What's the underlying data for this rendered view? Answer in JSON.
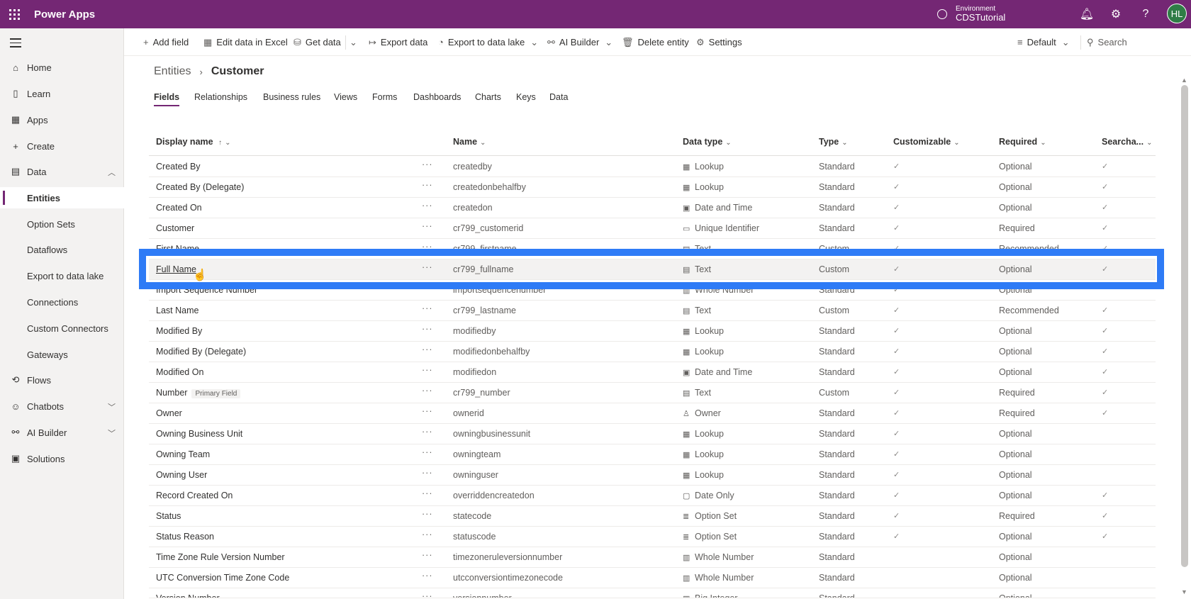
{
  "app": {
    "title": "Power Apps"
  },
  "environment": {
    "label": "Environment",
    "name": "CDSTutorial"
  },
  "user": {
    "initials": "HL"
  },
  "sidebar": {
    "items": [
      {
        "label": "Home",
        "icon": "home-icon"
      },
      {
        "label": "Learn",
        "icon": "book-icon"
      },
      {
        "label": "Apps",
        "icon": "apps-icon"
      },
      {
        "label": "Create",
        "icon": "plus-icon"
      },
      {
        "label": "Data",
        "icon": "table-icon"
      },
      {
        "label": "Entities"
      },
      {
        "label": "Option Sets"
      },
      {
        "label": "Dataflows"
      },
      {
        "label": "Export to data lake"
      },
      {
        "label": "Connections"
      },
      {
        "label": "Custom Connectors"
      },
      {
        "label": "Gateways"
      },
      {
        "label": "Flows",
        "icon": "flow-icon"
      },
      {
        "label": "Chatbots",
        "icon": "bot-icon"
      },
      {
        "label": "AI Builder",
        "icon": "ai-icon"
      },
      {
        "label": "Solutions",
        "icon": "solutions-icon"
      }
    ]
  },
  "commands": {
    "add_field": "Add field",
    "edit_excel": "Edit data in Excel",
    "get_data": "Get data",
    "export_data": "Export data",
    "export_lake": "Export to data lake",
    "ai_builder": "AI Builder",
    "delete_entity": "Delete entity",
    "settings": "Settings",
    "view_default": "Default",
    "search_placeholder": "Search"
  },
  "breadcrumb": {
    "root": "Entities",
    "current": "Customer"
  },
  "tabs": [
    "Fields",
    "Relationships",
    "Business rules",
    "Views",
    "Forms",
    "Dashboards",
    "Charts",
    "Keys",
    "Data"
  ],
  "columns": {
    "display_name": "Display name",
    "name": "Name",
    "data_type": "Data type",
    "type": "Type",
    "customizable": "Customizable",
    "required": "Required",
    "searchable": "Searcha..."
  },
  "rows": [
    {
      "display": "Created By",
      "name": "createdby",
      "dtype": "Lookup",
      "type": "Standard",
      "cust": "✓",
      "req": "Optional",
      "search": "✓"
    },
    {
      "display": "Created By (Delegate)",
      "name": "createdonbehalfby",
      "dtype": "Lookup",
      "type": "Standard",
      "cust": "✓",
      "req": "Optional",
      "search": "✓"
    },
    {
      "display": "Created On",
      "name": "createdon",
      "dtype": "Date and Time",
      "type": "Standard",
      "cust": "✓",
      "req": "Optional",
      "search": "✓"
    },
    {
      "display": "Customer",
      "name": "cr799_customerid",
      "dtype": "Unique Identifier",
      "type": "Standard",
      "cust": "✓",
      "req": "Required",
      "search": "✓"
    },
    {
      "display": "First Name",
      "name": "cr799_firstname",
      "dtype": "Text",
      "type": "Custom",
      "cust": "✓",
      "req": "Recommended",
      "search": "✓"
    },
    {
      "display": "Full Name",
      "name": "cr799_fullname",
      "dtype": "Text",
      "type": "Custom",
      "cust": "✓",
      "req": "Optional",
      "search": "✓"
    },
    {
      "display": "Import Sequence Number",
      "name": "importsequencenumber",
      "dtype": "Whole Number",
      "type": "Standard",
      "cust": "✓",
      "req": "Optional",
      "search": ""
    },
    {
      "display": "Last Name",
      "name": "cr799_lastname",
      "dtype": "Text",
      "type": "Custom",
      "cust": "✓",
      "req": "Recommended",
      "search": "✓"
    },
    {
      "display": "Modified By",
      "name": "modifiedby",
      "dtype": "Lookup",
      "type": "Standard",
      "cust": "✓",
      "req": "Optional",
      "search": "✓"
    },
    {
      "display": "Modified By (Delegate)",
      "name": "modifiedonbehalfby",
      "dtype": "Lookup",
      "type": "Standard",
      "cust": "✓",
      "req": "Optional",
      "search": "✓"
    },
    {
      "display": "Modified On",
      "name": "modifiedon",
      "dtype": "Date and Time",
      "type": "Standard",
      "cust": "✓",
      "req": "Optional",
      "search": "✓"
    },
    {
      "display": "Number",
      "badge": "Primary Field",
      "name": "cr799_number",
      "dtype": "Text",
      "type": "Custom",
      "cust": "✓",
      "req": "Required",
      "search": "✓"
    },
    {
      "display": "Owner",
      "name": "ownerid",
      "dtype": "Owner",
      "type": "Standard",
      "cust": "✓",
      "req": "Required",
      "search": "✓"
    },
    {
      "display": "Owning Business Unit",
      "name": "owningbusinessunit",
      "dtype": "Lookup",
      "type": "Standard",
      "cust": "✓",
      "req": "Optional",
      "search": ""
    },
    {
      "display": "Owning Team",
      "name": "owningteam",
      "dtype": "Lookup",
      "type": "Standard",
      "cust": "✓",
      "req": "Optional",
      "search": ""
    },
    {
      "display": "Owning User",
      "name": "owninguser",
      "dtype": "Lookup",
      "type": "Standard",
      "cust": "✓",
      "req": "Optional",
      "search": ""
    },
    {
      "display": "Record Created On",
      "name": "overriddencreatedon",
      "dtype": "Date Only",
      "type": "Standard",
      "cust": "✓",
      "req": "Optional",
      "search": "✓"
    },
    {
      "display": "Status",
      "name": "statecode",
      "dtype": "Option Set",
      "type": "Standard",
      "cust": "✓",
      "req": "Required",
      "search": "✓"
    },
    {
      "display": "Status Reason",
      "name": "statuscode",
      "dtype": "Option Set",
      "type": "Standard",
      "cust": "✓",
      "req": "Optional",
      "search": "✓"
    },
    {
      "display": "Time Zone Rule Version Number",
      "name": "timezoneruleversionnumber",
      "dtype": "Whole Number",
      "type": "Standard",
      "cust": "",
      "req": "Optional",
      "search": ""
    },
    {
      "display": "UTC Conversion Time Zone Code",
      "name": "utcconversiontimezonecode",
      "dtype": "Whole Number",
      "type": "Standard",
      "cust": "",
      "req": "Optional",
      "search": ""
    },
    {
      "display": "Version Number",
      "name": "versionnumber",
      "dtype": "Big Integer",
      "type": "Standard",
      "cust": "",
      "req": "Optional",
      "search": ""
    }
  ]
}
